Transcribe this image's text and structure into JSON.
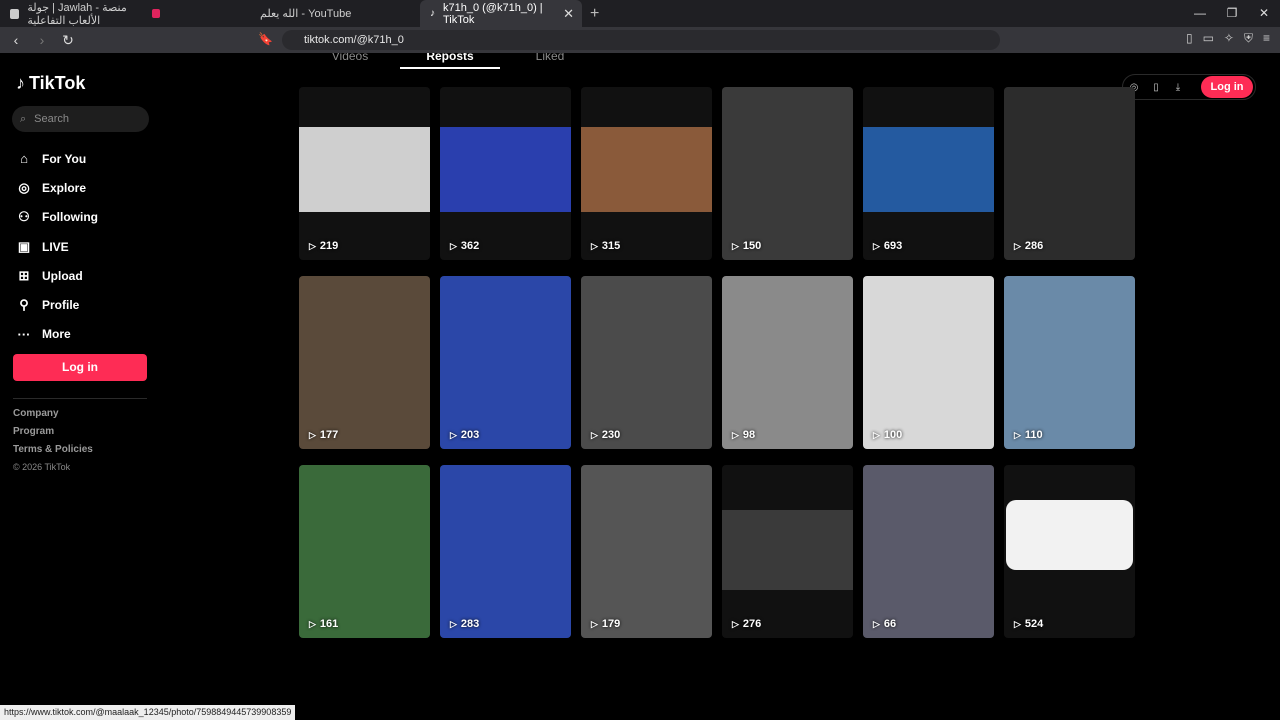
{
  "browser": {
    "tabs": [
      {
        "title": "جولة | Jawlah - منصة الألعاب التفاعلية"
      },
      {
        "title": "الله يعلم - YouTube"
      },
      {
        "title": "k71h_0 (@k71h_0) | TikTok"
      }
    ],
    "url": "tiktok.com/@k71h_0",
    "status_url": "https://www.tiktok.com/@maalaak_12345/photo/7598849445739908359"
  },
  "sidebar": {
    "logo": "TikTok",
    "search_placeholder": "Search",
    "items": [
      {
        "label": "For You",
        "icon": "home-icon"
      },
      {
        "label": "Explore",
        "icon": "compass-icon"
      },
      {
        "label": "Following",
        "icon": "following-icon"
      },
      {
        "label": "LIVE",
        "icon": "live-icon"
      },
      {
        "label": "Upload",
        "icon": "upload-icon"
      },
      {
        "label": "Profile",
        "icon": "profile-icon"
      },
      {
        "label": "More",
        "icon": "more-icon"
      }
    ],
    "login_label": "Log in",
    "footer": [
      "Company",
      "Program",
      "Terms & Policies"
    ],
    "copyright": "© 2026 TikTok"
  },
  "profile_tabs": [
    {
      "label": "Videos",
      "active": false
    },
    {
      "label": "Reposts",
      "active": true
    },
    {
      "label": "Liked",
      "active": false
    }
  ],
  "top_login_label": "Log in",
  "videos": [
    {
      "views": "219",
      "tone": "#cfcfcf",
      "thumb": "short-top"
    },
    {
      "views": "362",
      "tone": "#2a3fae",
      "thumb": "short-top"
    },
    {
      "views": "315",
      "tone": "#8a5a3a",
      "thumb": "short-top"
    },
    {
      "views": "150",
      "tone": "#3a3a3a",
      "thumb": "full"
    },
    {
      "views": "693",
      "tone": "#245aa0",
      "thumb": "short-top"
    },
    {
      "views": "286",
      "tone": "#2c2c2c",
      "thumb": "full"
    },
    {
      "views": "177",
      "tone": "#5a4a3a",
      "thumb": "full"
    },
    {
      "views": "203",
      "tone": "#2b47a8",
      "thumb": "full"
    },
    {
      "views": "230",
      "tone": "#4b4b4b",
      "thumb": "full"
    },
    {
      "views": "98",
      "tone": "#8a8a8a",
      "thumb": "full"
    },
    {
      "views": "100",
      "tone": "#d8d8d8",
      "thumb": "full"
    },
    {
      "views": "110",
      "tone": "#6a8aa8",
      "thumb": "full"
    },
    {
      "views": "161",
      "tone": "#3a6a3a",
      "thumb": "full"
    },
    {
      "views": "283",
      "tone": "#2b47a8",
      "thumb": "full"
    },
    {
      "views": "179",
      "tone": "#555555",
      "thumb": "full"
    },
    {
      "views": "276",
      "tone": "#3a3a3a",
      "thumb": "mid"
    },
    {
      "views": "66",
      "tone": "#5a5a6a",
      "thumb": "full"
    },
    {
      "views": "524",
      "tone": "#f2f2f2",
      "thumb": "card"
    }
  ],
  "brand_color": "#fe2c55"
}
